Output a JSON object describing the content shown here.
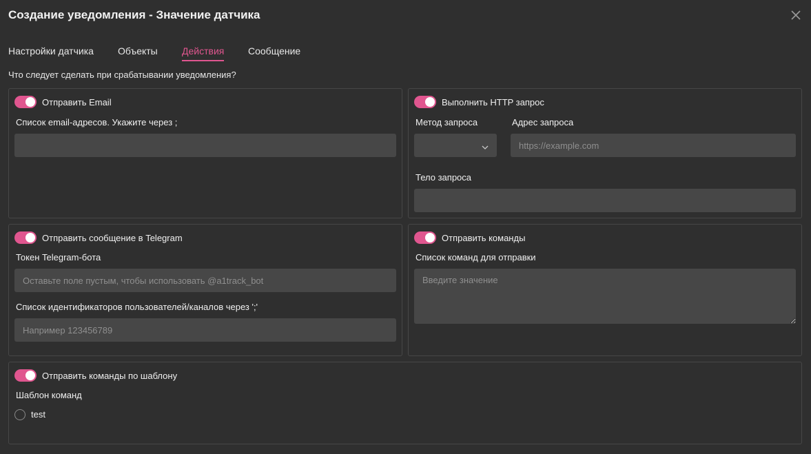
{
  "dialog": {
    "title": "Создание уведомления - Значение датчика",
    "close_icon": "close-icon"
  },
  "tabs": [
    {
      "label": "Настройки датчика",
      "active": false
    },
    {
      "label": "Объекты",
      "active": false
    },
    {
      "label": "Действия",
      "active": true
    },
    {
      "label": "Сообщение",
      "active": false
    }
  ],
  "question": "Что следует сделать при срабатывании уведомления?",
  "email": {
    "toggle_label": "Отправить Email",
    "enabled": true,
    "field_label": "Список email-адресов. Укажите через ;",
    "value": ""
  },
  "http": {
    "toggle_label": "Выполнить HTTP запрос",
    "enabled": true,
    "method_label": "Метод запроса",
    "method_value": "",
    "url_label": "Адрес запроса",
    "url_placeholder": "https://example.com",
    "body_label": "Тело запроса",
    "body_value": ""
  },
  "telegram": {
    "toggle_label": "Отправить сообщение в Telegram",
    "enabled": true,
    "token_label": "Токен Telegram-бота",
    "token_placeholder": "Оставьте поле пустым, чтобы использовать @a1track_bot",
    "ids_label": "Список идентификаторов пользователей/каналов через ';'",
    "ids_placeholder": "Например 123456789"
  },
  "commands": {
    "toggle_label": "Отправить команды",
    "enabled": true,
    "list_label": "Список команд для отправки",
    "list_placeholder": "Введите значение"
  },
  "template_commands": {
    "toggle_label": "Отправить команды по шаблону",
    "enabled": true,
    "template_label": "Шаблон команд",
    "options": [
      {
        "label": "test",
        "selected": false
      }
    ]
  },
  "colors": {
    "background": "#2f2f2f",
    "accent": "#e0568f",
    "input_bg": "#474747",
    "border": "#474747"
  }
}
